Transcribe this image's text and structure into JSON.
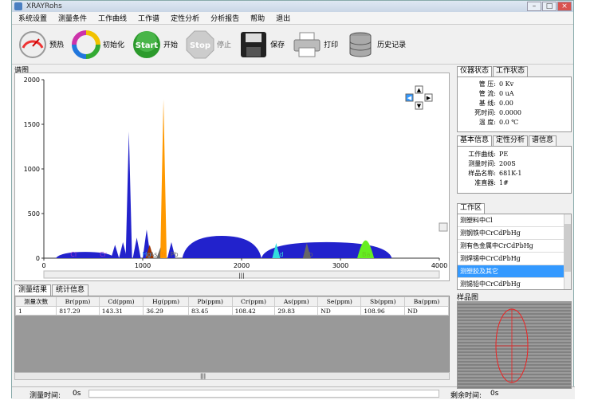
{
  "window": {
    "title": "XRAYRohs"
  },
  "menu": [
    "系统设置",
    "测量条件",
    "工作曲线",
    "工作谱",
    "定性分析",
    "分析报告",
    "帮助",
    "退出"
  ],
  "toolbar": {
    "preheat": "预热",
    "init": "初始化",
    "start_icon_text": "Start",
    "start": "开始",
    "stop_icon_text": "Stop",
    "stop": "停止",
    "save": "保存",
    "print": "打印",
    "history": "历史记录"
  },
  "spectrum_label": "谱图",
  "chart_data": {
    "type": "line",
    "xlim": [
      0,
      4000
    ],
    "ylim": [
      0,
      2000
    ],
    "x_ticks": [
      "0",
      "1000",
      "2000",
      "3000",
      "4000"
    ],
    "y_ticks": [
      "0",
      "500",
      "1000",
      "1500",
      "2000"
    ],
    "peaks": [
      {
        "x": 350,
        "y": 60,
        "color": "#2222cc"
      },
      {
        "x": 720,
        "y": 150,
        "color": "#2222cc"
      },
      {
        "x": 800,
        "y": 180,
        "color": "#2222cc"
      },
      {
        "x": 860,
        "y": 1420,
        "color": "#2222cc"
      },
      {
        "x": 940,
        "y": 230,
        "color": "#2222cc"
      },
      {
        "x": 1040,
        "y": 320,
        "color": "#2222cc"
      },
      {
        "x": 1070,
        "y": 150,
        "color": "#993300"
      },
      {
        "x": 1180,
        "y": 120,
        "color": "#666666"
      },
      {
        "x": 1210,
        "y": 1780,
        "color": "#ff9900"
      },
      {
        "x": 1290,
        "y": 180,
        "color": "#2222cc"
      },
      {
        "x": 1500,
        "y": 160,
        "color": "#2222cc"
      },
      {
        "x": 1850,
        "y": 240,
        "color": "#2222cc"
      },
      {
        "x": 2350,
        "y": 170,
        "color": "#33dddd"
      },
      {
        "x": 2660,
        "y": 170,
        "color": "#666666"
      }
    ],
    "bands": [
      {
        "x0": 120,
        "x1": 720,
        "y": 70,
        "color": "#2222cc"
      },
      {
        "x0": 1400,
        "x1": 2200,
        "y": 250,
        "color": "#2222cc"
      },
      {
        "x0": 2200,
        "x1": 3520,
        "y": 180,
        "color": "#2222cc"
      },
      {
        "x0": 3170,
        "x1": 3340,
        "y": 200,
        "color": "#66ee22"
      }
    ],
    "element_markers": [
      {
        "label": "Cl",
        "x": 300,
        "color": "#9933cc"
      },
      {
        "label": "Cr",
        "x": 600,
        "color": "#9933cc"
      },
      {
        "label": "Hg",
        "x": 1040,
        "color": "#3399ff"
      },
      {
        "label": "As",
        "x": 1110,
        "color": "#666666"
      },
      {
        "label": "Br",
        "x": 1205,
        "color": "#ff8800"
      },
      {
        "label": "Pb",
        "x": 1320,
        "color": "#666666"
      },
      {
        "label": "Cd",
        "x": 2380,
        "color": "#33dddd"
      },
      {
        "label": "Sb",
        "x": 2680,
        "color": "#666666"
      },
      {
        "label": "Ba",
        "x": 3260,
        "color": "#66cc22"
      }
    ]
  },
  "results_tabs": [
    "测量结果",
    "统计信息"
  ],
  "results": {
    "headers": [
      "测量次数",
      "Br(ppm)",
      "Cd(ppm)",
      "Hg(ppm)",
      "Pb(ppm)",
      "Cr(ppm)",
      "As(ppm)",
      "Se(ppm)",
      "Sb(ppm)",
      "Ba(ppm)"
    ],
    "rows": [
      [
        "1",
        "817.29",
        "143.31",
        "36.29",
        "83.45",
        "108.42",
        "29.83",
        "ND",
        "108.96",
        "ND"
      ]
    ]
  },
  "status": {
    "measure_time_label": "测量时间:",
    "measure_time": "0s",
    "remaining_label": "剩余时间:",
    "remaining": "0s"
  },
  "instrument": {
    "tabs": [
      "仪器状态",
      "工作状态"
    ],
    "rows": [
      {
        "k": "管  压:",
        "v": "0 Kv"
      },
      {
        "k": "管  流:",
        "v": "0 uA"
      },
      {
        "k": "基  线:",
        "v": "0.00"
      },
      {
        "k": "死时间:",
        "v": "0.0000"
      },
      {
        "k": "温  度:",
        "v": "0.0 ℃"
      }
    ]
  },
  "basic": {
    "tabs": [
      "基本信息",
      "定性分析",
      "谱信息"
    ],
    "rows": [
      {
        "k": "工作曲线:",
        "v": "PE"
      },
      {
        "k": "测量时间:",
        "v": "200S"
      },
      {
        "k": "样品名称:",
        "v": "681K-1"
      },
      {
        "k": "准直器:",
        "v": "1#"
      }
    ]
  },
  "workarea": {
    "tab": "工作区",
    "items": [
      "测塑料中Cl",
      "测钢铁中CrCdPbHg",
      "测有色金属中CrCdPbHg",
      "测焊锡中CrCdPbHg",
      "测塑胶及其它",
      "测锡铅中CrCdPbHg"
    ],
    "selected": 4
  },
  "sample_label": "样品图"
}
